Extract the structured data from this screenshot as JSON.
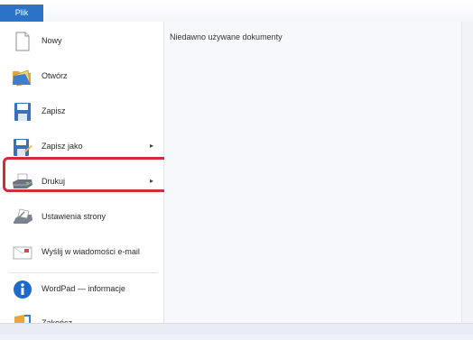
{
  "ribbon": {
    "file_tab": "Plik"
  },
  "menu": {
    "items": [
      {
        "label": "Nowy",
        "icon": "new-document-icon"
      },
      {
        "label": "Otwórz",
        "icon": "open-folder-icon"
      },
      {
        "label": "Zapisz",
        "icon": "save-disk-icon"
      },
      {
        "label": "Zapisz jako",
        "icon": "save-as-icon",
        "has_submenu": true
      },
      {
        "label": "Drukuj",
        "icon": "printer-icon",
        "has_submenu": true
      },
      {
        "label": "Ustawienia strony",
        "icon": "page-setup-icon"
      },
      {
        "label": "Wyślij w wiadomości e-mail",
        "icon": "email-icon"
      },
      {
        "label": "WordPad — informacje",
        "icon": "info-icon"
      },
      {
        "label": "Zakończ",
        "icon": "exit-icon"
      }
    ],
    "submenu_arrow": "▸"
  },
  "recent": {
    "title": "Niedawno używane dokumenty"
  },
  "colors": {
    "accent": "#2b73c9",
    "highlight_border": "#d02c3a"
  }
}
